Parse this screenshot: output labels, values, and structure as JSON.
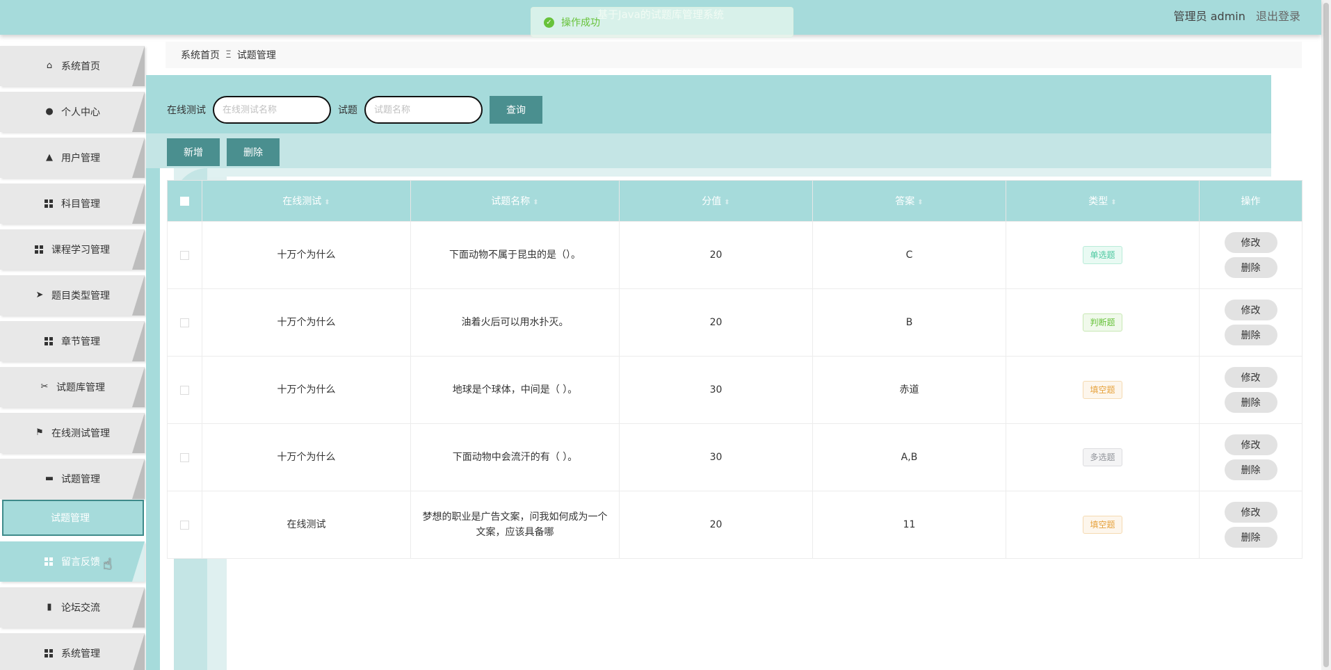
{
  "header": {
    "title": "基于Java的试题库管理系统",
    "user_label": "管理员 admin",
    "logout_label": "退出登录"
  },
  "toast": {
    "message": "操作成功"
  },
  "sidebar": {
    "items": [
      {
        "label": "系统首页",
        "icon": "home-icon"
      },
      {
        "label": "个人中心",
        "icon": "user-icon"
      },
      {
        "label": "用户管理",
        "icon": "user-manage-icon"
      },
      {
        "label": "科目管理",
        "icon": "grid-icon"
      },
      {
        "label": "课程学习管理",
        "icon": "grid-icon"
      },
      {
        "label": "题目类型管理",
        "icon": "send-icon"
      },
      {
        "label": "章节管理",
        "icon": "grid-icon"
      },
      {
        "label": "试题库管理",
        "icon": "ticket-icon"
      },
      {
        "label": "在线测试管理",
        "icon": "flag-icon"
      },
      {
        "label": "试题管理",
        "icon": "monitor-icon"
      }
    ],
    "sub_item": "试题管理",
    "items_after": [
      {
        "label": "留言反馈",
        "icon": "grid-icon"
      },
      {
        "label": "论坛交流",
        "icon": "clipboard-icon"
      },
      {
        "label": "系统管理",
        "icon": "grid-icon"
      }
    ]
  },
  "breadcrumb": {
    "home": "系统首页",
    "separator": "Ξ",
    "current": "试题管理"
  },
  "search": {
    "test_label": "在线测试",
    "test_placeholder": "在线测试名称",
    "question_label": "试题",
    "question_placeholder": "试题名称",
    "query_button": "查询"
  },
  "actions": {
    "add": "新增",
    "delete": "删除"
  },
  "table": {
    "columns": [
      "在线测试",
      "试题名称",
      "分值",
      "答案",
      "类型",
      "操作"
    ],
    "rows": [
      {
        "test": "十万个为什么",
        "name": "下面动物不属于昆虫的是（）。",
        "score": "20",
        "answer": "C",
        "type": "单选题",
        "type_class": "single"
      },
      {
        "test": "十万个为什么",
        "name": "油着火后可以用水扑灭。",
        "score": "20",
        "answer": "B",
        "type": "判断题",
        "type_class": "judge"
      },
      {
        "test": "十万个为什么",
        "name": "地球是个球体，中间是（ ）。",
        "score": "30",
        "answer": "赤道",
        "type": "填空题",
        "type_class": "fill"
      },
      {
        "test": "十万个为什么",
        "name": "下面动物中会流汗的有（ ）。",
        "score": "30",
        "answer": "A,B",
        "type": "多选题",
        "type_class": "multi"
      },
      {
        "test": "在线测试",
        "name": "梦想的职业是广告文案，问我如何成为一个文案，应该具备哪",
        "score": "20",
        "answer": "11",
        "type": "填空题",
        "type_class": "fill"
      }
    ],
    "edit_label": "修改",
    "delete_label": "删除"
  }
}
